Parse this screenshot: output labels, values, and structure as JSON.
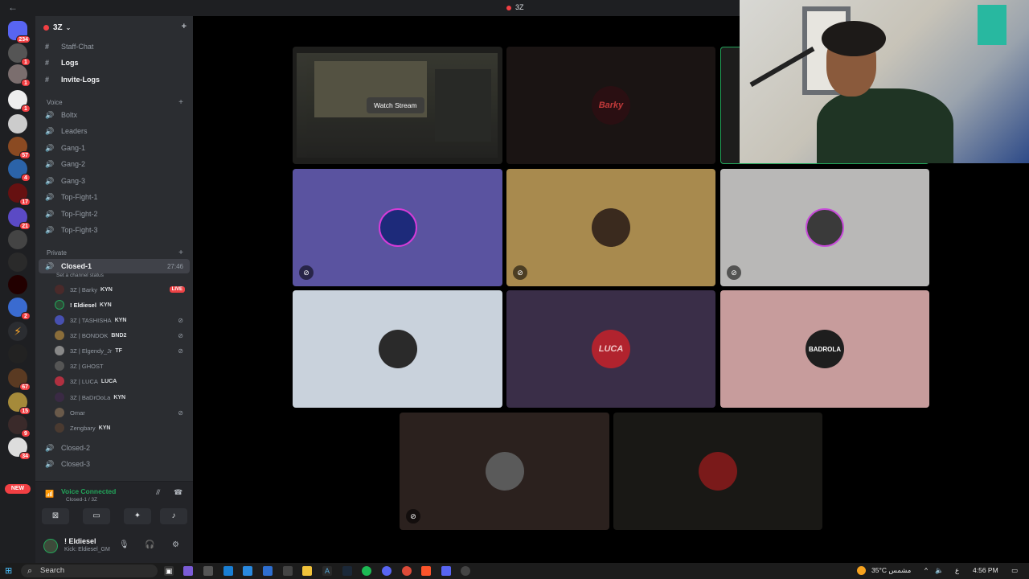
{
  "window": {
    "title": "3Z"
  },
  "server": {
    "name": "3Z"
  },
  "rail_badges": [
    "234",
    "1",
    "1",
    "1",
    "57",
    "4",
    "17",
    "21",
    "2",
    "67",
    "15",
    "9",
    "34"
  ],
  "rail_new": "NEW",
  "text_channels": [
    "Staff-Chat",
    "Logs",
    "Invite-Logs"
  ],
  "categories": {
    "voice": "Voice",
    "private": "Private"
  },
  "voice_channels": [
    "Boltx",
    "Leaders",
    "Gang-1",
    "Gang-2",
    "Gang-3",
    "Top-Fight-1",
    "Top-Fight-2",
    "Top-Fight-3"
  ],
  "private_channels": {
    "active": {
      "name": "Closed-1",
      "time": "27:46",
      "status": "Set a channel status"
    },
    "others": [
      "Closed-2",
      "Closed-3"
    ]
  },
  "members": [
    {
      "name": "3Z | Barky",
      "tag": "KYN",
      "live": "LIVE"
    },
    {
      "name": "! Eldiesel",
      "tag": "KYN"
    },
    {
      "name": "3Z | TASHISHA",
      "tag": "KYN"
    },
    {
      "name": "3Z | BONDOK",
      "tag": "BND2"
    },
    {
      "name": "3Z | Elgendy_Jr",
      "tag": "TF"
    },
    {
      "name": "3Z | GHOST",
      "tag": ""
    },
    {
      "name": "3Z | LUCA",
      "tag": "LUCA"
    },
    {
      "name": "3Z | BaDrOoLa",
      "tag": "KYN"
    },
    {
      "name": "Omar",
      "tag": ""
    },
    {
      "name": "Zengbary",
      "tag": "KYN"
    }
  ],
  "voice_panel": {
    "status": "Voice Connected",
    "channel": "Closed-1 / 3Z"
  },
  "user_panel": {
    "name": "! Eldiesel",
    "status": "Kick: Eldiesel_GM"
  },
  "stage": {
    "watch_stream": "Watch Stream",
    "tiles": [
      {
        "label": "Barky",
        "color": "#1a1413"
      },
      {
        "label": "",
        "color": "#5a53a0"
      },
      {
        "label": "",
        "color": "#a88a4e"
      },
      {
        "label": "",
        "color": "#b9b8b7"
      },
      {
        "label": "",
        "color": "#c9d2dc"
      },
      {
        "label": "LUCA",
        "color": "#3a2e48"
      },
      {
        "label": "BADROLA",
        "color": "#c79c9c"
      },
      {
        "label": "",
        "color": "#2b211e"
      },
      {
        "label": "",
        "color": "#191815"
      }
    ]
  },
  "taskbar": {
    "search": "Search",
    "weather": "35°C مشمس",
    "lang": "ع",
    "time": "4:56 PM"
  }
}
